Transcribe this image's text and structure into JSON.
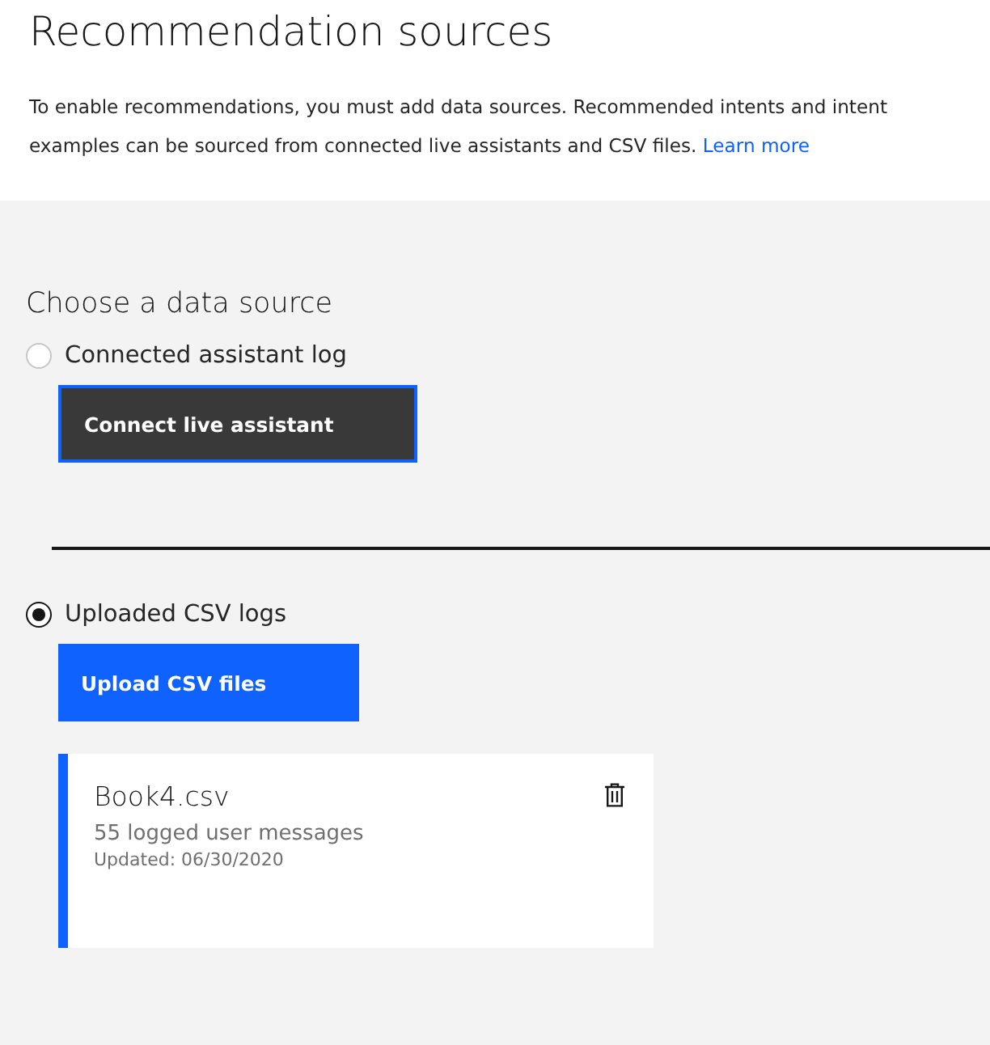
{
  "header": {
    "title": "Recommendation sources",
    "description": "To enable recommendations, you must add data sources. Recommended intents and intent examples can be sourced from connected live assistants and CSV files.",
    "link": "Learn more"
  },
  "section": {
    "title": "Choose a data source",
    "sources": [
      {
        "label": "Connected assistant log",
        "selected": false,
        "button": {
          "label": "Connect live assistant",
          "kind": "secondary",
          "focused": true
        }
      },
      {
        "label": "Uploaded CSV logs",
        "selected": true,
        "button": {
          "label": "Upload CSV files",
          "kind": "primary",
          "focused": false
        },
        "files": [
          {
            "name": "Book4.csv",
            "count": "55 logged user messages",
            "updated": "Updated: 06/30/2020"
          }
        ]
      }
    ]
  }
}
